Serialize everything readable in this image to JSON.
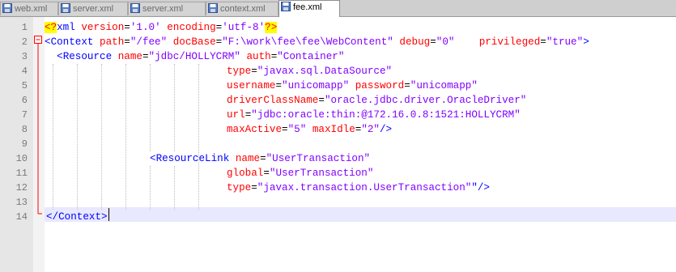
{
  "tabs": [
    {
      "label": "web.xml",
      "active": false,
      "icon": "floppy-disk-icon"
    },
    {
      "label": "server.xml",
      "active": false,
      "icon": "floppy-disk-icon"
    },
    {
      "label": "server.xml",
      "active": false,
      "icon": "floppy-disk-icon"
    },
    {
      "label": "context.xml",
      "active": false,
      "icon": "floppy-disk-icon"
    },
    {
      "label": "fee.xml",
      "active": true,
      "icon": "floppy-disk-icon"
    }
  ],
  "line_numbers": [
    "1",
    "2",
    "3",
    "4",
    "5",
    "6",
    "7",
    "8",
    "9",
    "10",
    "11",
    "12",
    "13",
    "14"
  ],
  "code": {
    "l1": {
      "pi_open": "<?",
      "xml": "xml",
      "a1": "version",
      "eq1": "=",
      "v1": "'1.0'",
      "a2": "encoding",
      "eq2": "=",
      "v2": "'utf-8'",
      "pi_close": "?>"
    },
    "l2": {
      "open": "<",
      "tag": "Context",
      "a1": "path",
      "v1": "\"/fee\"",
      "a2": "docBase",
      "v2": "\"F:\\work\\fee\\fee\\WebContent\"",
      "a3": "debug",
      "v3": "\"0\"",
      "a4": "privileged",
      "v4": "\"true\"",
      "close": ">"
    },
    "l3": {
      "open": "<",
      "tag": "Resource",
      "a1": "name",
      "v1": "\"jdbc/HOLLYCRM\"",
      "a2": "auth",
      "v2": "\"Container\""
    },
    "l4": {
      "a": "type",
      "v": "\"javax.sql.DataSource\""
    },
    "l5": {
      "a1": "username",
      "v1": "\"unicomapp\"",
      "a2": "password",
      "v2": "\"unicomapp\""
    },
    "l6": {
      "a": "driverClassName",
      "v": "\"oracle.jdbc.driver.OracleDriver\""
    },
    "l7": {
      "a": "url",
      "v": "\"jdbc:oracle:thin:@172.16.0.8:1521:HOLLYCRM\""
    },
    "l8": {
      "a1": "maxActive",
      "v1": "\"5\"",
      "a2": "maxIdle",
      "v2": "\"2\"",
      "close": "/>"
    },
    "l10": {
      "open": "<",
      "tag": "ResourceLink",
      "a1": "name",
      "v1": "\"UserTransaction\""
    },
    "l11": {
      "a": "global",
      "v": "\"UserTransaction\""
    },
    "l12": {
      "a": "type",
      "v": "\"javax.transaction.UserTransaction\"",
      "close": "\"/>"
    },
    "l14": {
      "open": "</",
      "tag": "Context",
      "close": ">"
    }
  },
  "colors": {
    "tag": "#0000ff",
    "attribute": "#ff0000",
    "value": "#8000ff",
    "highlight": "#ffff00",
    "current_line": "#e8e8ff"
  }
}
